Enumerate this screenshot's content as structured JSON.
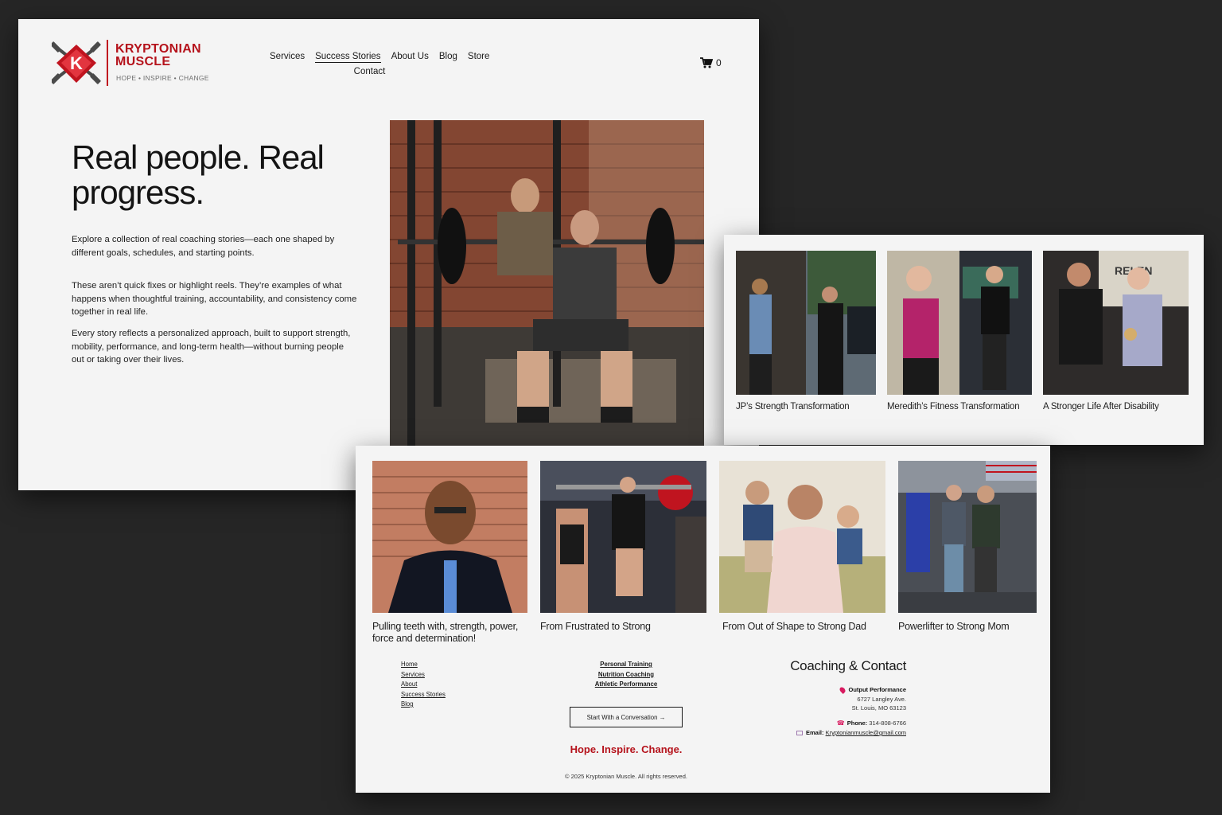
{
  "brand": {
    "name": "KRYPTONIAN MUSCLE",
    "tagline": "HOPE • INSPIRE • CHANGE",
    "red": "#b5121b"
  },
  "nav": {
    "items": [
      "Services",
      "Success Stories",
      "About Us",
      "Blog",
      "Store"
    ],
    "second_row": "Contact",
    "active": "Success Stories"
  },
  "cart": {
    "count": "0"
  },
  "hero": {
    "title": "Real people. Real progress.",
    "p1": "Explore a collection of real coaching stories—each one shaped by different goals, schedules, and starting points.",
    "p2": "These aren’t quick fixes or highlight reels. They’re examples of what happens when thoughtful training, accountability, and consistency come together in real life.",
    "p3": "Every story reflects a personalized approach, built to support strength, mobility, performance, and long-term health—without burning people out or taking over their lives."
  },
  "stories": [
    {
      "title": "JP’s Strength Transformation"
    },
    {
      "title": "Meredith’s Fitness Transformation"
    },
    {
      "title": "A Stronger Life After Disability"
    }
  ],
  "more_stories": [
    {
      "title": "Pulling teeth with, strength, power, force and determination!"
    },
    {
      "title": "From Frustrated to Strong"
    },
    {
      "title": "From Out of Shape to Strong Dad"
    },
    {
      "title": "Powerlifter to Strong Mom"
    }
  ],
  "footer": {
    "links": [
      "Home",
      "Services",
      "About",
      "Success Stories",
      "Blog"
    ],
    "services": [
      "Personal Training",
      "Nutrition Coaching",
      "Athletic Performance"
    ],
    "cta": "Start With a Conversation →",
    "slogan": "Hope. Inspire. Change.",
    "copyright": "© 2025 Kryptonian Muscle. All rights reserved.",
    "contact_heading": "Coaching & Contact",
    "location_name": "Output Performance",
    "address1": "6727 Langley Ave.",
    "address2": "St. Louis, MO 63123",
    "phone_label": "Phone:",
    "phone": "314-808-6766",
    "email_label": "Email:",
    "email": "Kryptonianmuscle@gmail.com"
  }
}
